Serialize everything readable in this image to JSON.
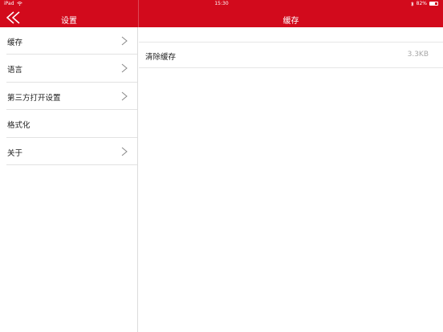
{
  "status_bar": {
    "carrier": "iPad",
    "wifi_icon": "wifi-icon",
    "time": "15:30",
    "bluetooth_icon": "bluetooth-icon",
    "battery_percent": "82%",
    "battery_icon": "battery-icon"
  },
  "header": {
    "back_icon": "double-chevron-left-icon",
    "left_title": "设置",
    "right_title": "缓存",
    "background_color": "#d20a1c"
  },
  "sidebar": {
    "items": [
      {
        "label": "缓存",
        "has_chevron": true
      },
      {
        "label": "语言",
        "has_chevron": true
      },
      {
        "label": "第三方打开设置",
        "has_chevron": true
      },
      {
        "label": "格式化",
        "has_chevron": false
      },
      {
        "label": "关于",
        "has_chevron": true
      }
    ]
  },
  "content": {
    "rows": [
      {
        "label": "清除缓存",
        "value": "3.3KB"
      }
    ]
  }
}
